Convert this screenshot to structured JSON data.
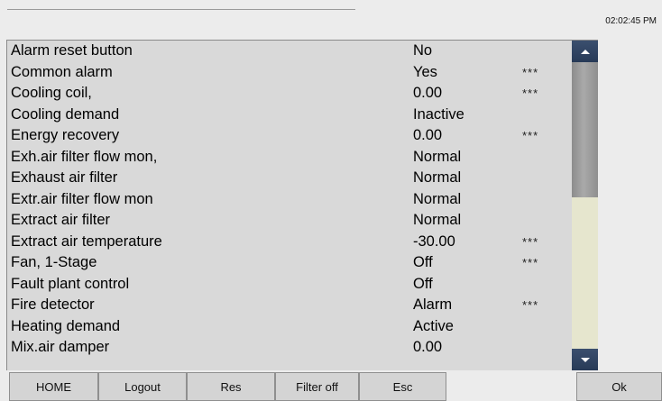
{
  "header": {
    "time": "02:02:45 PM"
  },
  "list": {
    "rows": [
      {
        "name": "Alarm reset button",
        "value": "No",
        "flag": ""
      },
      {
        "name": "Common alarm",
        "value": "Yes",
        "flag": "***"
      },
      {
        "name": "Cooling coil,",
        "value": "0.00",
        "flag": "***"
      },
      {
        "name": "Cooling demand",
        "value": "Inactive",
        "flag": ""
      },
      {
        "name": "Energy recovery",
        "value": "0.00",
        "flag": "***"
      },
      {
        "name": "Exh.air filter flow mon,",
        "value": "Normal",
        "flag": ""
      },
      {
        "name": "Exhaust air filter",
        "value": "Normal",
        "flag": ""
      },
      {
        "name": "Extr.air filter flow mon",
        "value": "Normal",
        "flag": ""
      },
      {
        "name": "Extract air filter",
        "value": "Normal",
        "flag": ""
      },
      {
        "name": "Extract air temperature",
        "value": "-30.00",
        "flag": "***"
      },
      {
        "name": "Fan, 1-Stage",
        "value": "Off",
        "flag": "***"
      },
      {
        "name": "Fault plant control",
        "value": "Off",
        "flag": ""
      },
      {
        "name": "Fire detector",
        "value": "Alarm",
        "flag": "***"
      },
      {
        "name": "Heating demand",
        "value": "Active",
        "flag": ""
      },
      {
        "name": "Mix.air damper",
        "value": "0.00",
        "flag": ""
      }
    ]
  },
  "scrollbar": {
    "up_icon": "chevron-up-icon",
    "down_icon": "chevron-down-icon",
    "position": 0
  },
  "toolbar": {
    "home_label": "HOME",
    "logout_label": "Logout",
    "res_label": "Res",
    "filter_label": "Filter off",
    "esc_label": "Esc",
    "ok_label": "Ok"
  }
}
